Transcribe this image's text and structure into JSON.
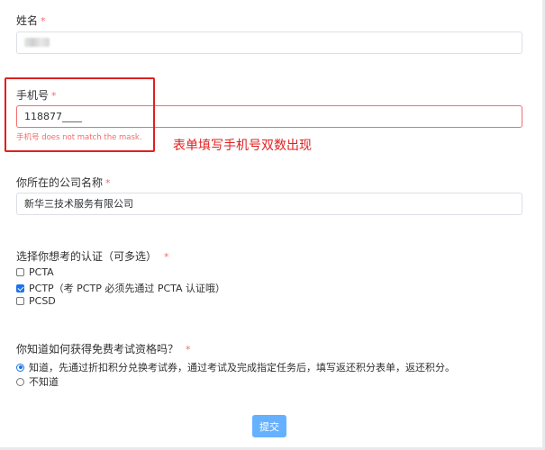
{
  "form": {
    "name": {
      "label": "姓名",
      "required": "*"
    },
    "phone": {
      "label": "手机号",
      "required": "*",
      "value": "118877____",
      "error": "手机号 does not match the mask."
    },
    "company": {
      "label": "你所在的公司名称",
      "required": "*",
      "value": "新华三技术服务有限公司"
    },
    "certs": {
      "label": "选择你想考的认证（可多选）",
      "required": "*",
      "options": [
        {
          "label": "PCTA",
          "checked": false
        },
        {
          "label": "PCTP（考 PCTP 必须先通过 PCTA 认证哦）",
          "checked": true
        },
        {
          "label": "PCSD",
          "checked": false
        }
      ]
    },
    "free_exam": {
      "label": "你知道如何获得免费考试资格吗？",
      "required": "*",
      "options": [
        {
          "label": "知道，先通过折扣积分兑换考试券，通过考试及完成指定任务后，填写返还积分表单，返还积分。",
          "checked": true
        },
        {
          "label": "不知道",
          "checked": false
        }
      ]
    },
    "submit_label": "提交"
  },
  "annotation": {
    "text": "表单填写手机号双数出现",
    "color": "#e02020"
  },
  "colors": {
    "error": "#f56c6c",
    "primary_light": "#66b1ff",
    "checkbox_accent": "#1a73e8"
  }
}
